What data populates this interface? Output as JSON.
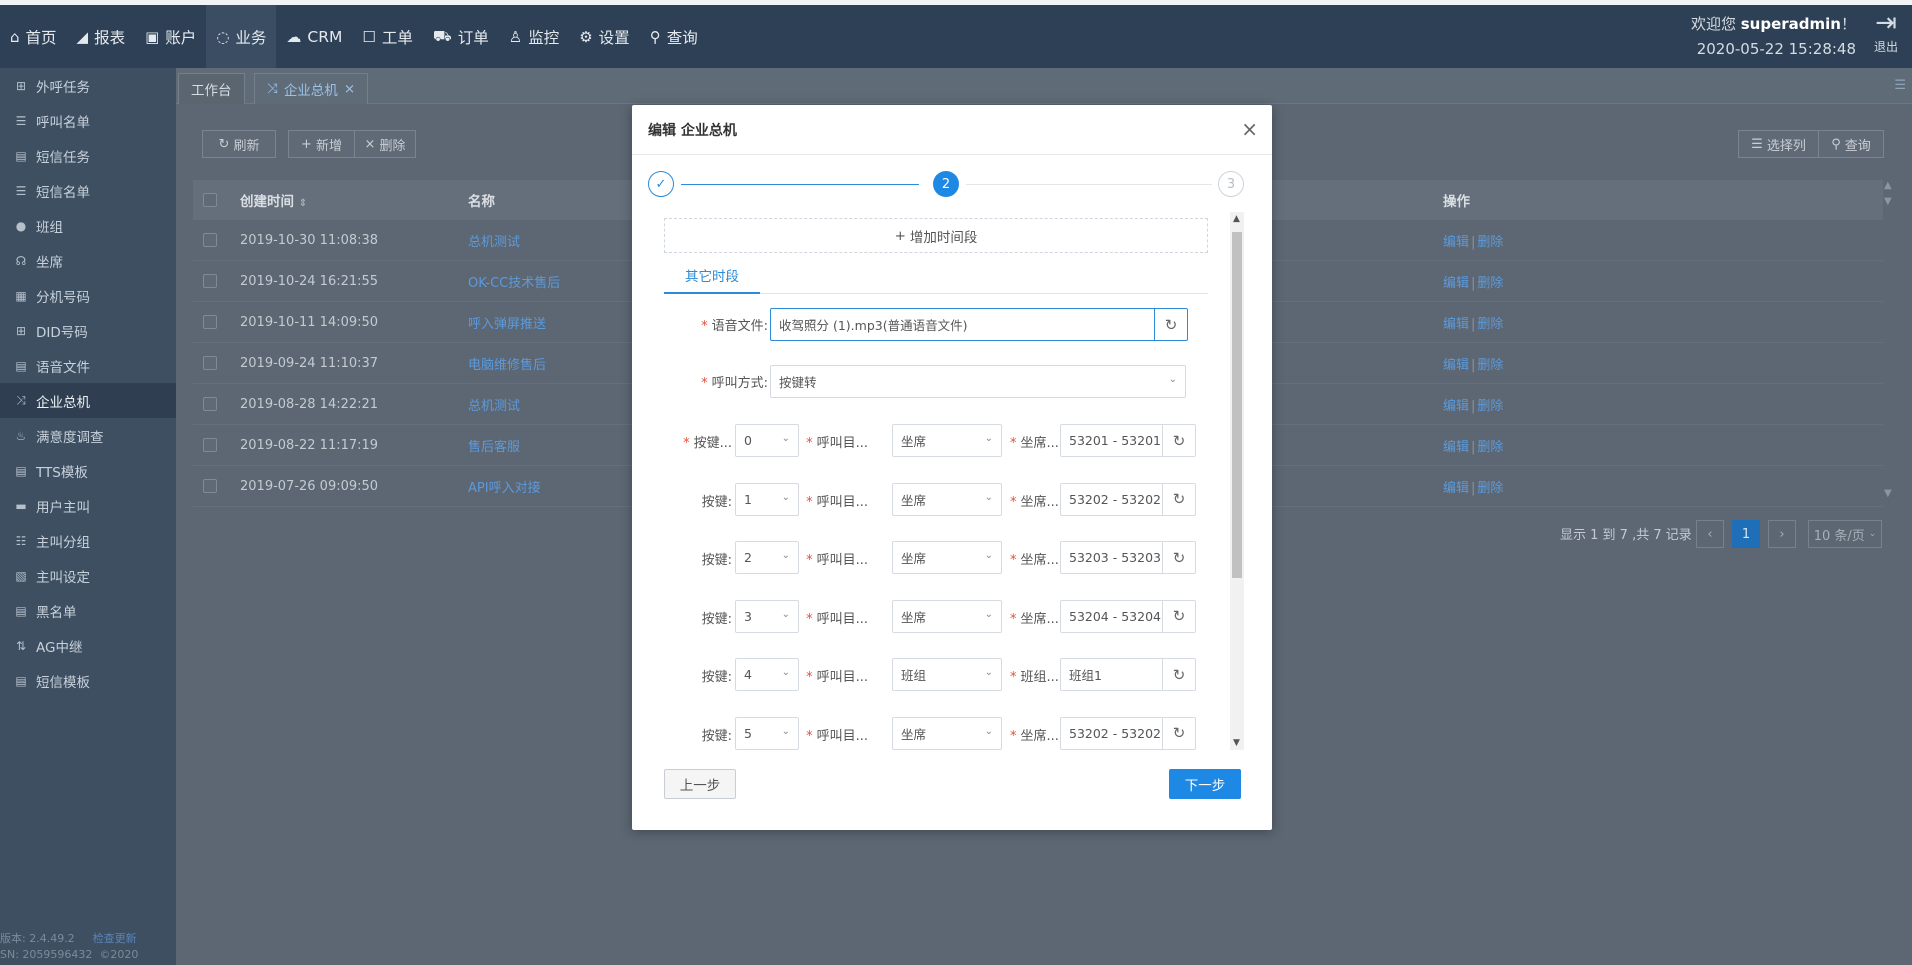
{
  "topnav": {
    "items": [
      {
        "icon": "home-icon",
        "glyph": "⌂",
        "label": "首页"
      },
      {
        "icon": "report-icon",
        "glyph": "◢",
        "label": "报表"
      },
      {
        "icon": "account-icon",
        "glyph": "▣",
        "label": "账户"
      },
      {
        "icon": "business-icon",
        "glyph": "◌",
        "label": "业务"
      },
      {
        "icon": "crm-icon",
        "glyph": "☁",
        "label": "CRM"
      },
      {
        "icon": "ticket-icon",
        "glyph": "☐",
        "label": "工单"
      },
      {
        "icon": "cart-icon",
        "glyph": "⛟",
        "label": "订单"
      },
      {
        "icon": "monitor-icon",
        "glyph": "♙",
        "label": "监控"
      },
      {
        "icon": "gear-icon",
        "glyph": "⚙",
        "label": "设置"
      },
      {
        "icon": "search-icon",
        "glyph": "⚲",
        "label": "查询"
      }
    ],
    "welcome_prefix": "欢迎您 ",
    "username": "superadmin",
    "welcome_suffix": "！",
    "datetime": "2020-05-22 15:28:48",
    "logout_label": "退出"
  },
  "sidebar": {
    "items": [
      {
        "icon": "grid-icon",
        "glyph": "⊞",
        "label": "外呼任务"
      },
      {
        "icon": "list-icon",
        "glyph": "☰",
        "label": "呼叫名单"
      },
      {
        "icon": "doc-icon",
        "glyph": "▤",
        "label": "短信任务"
      },
      {
        "icon": "list-icon",
        "glyph": "☰",
        "label": "短信名单"
      },
      {
        "icon": "group-icon",
        "glyph": "●",
        "label": "班组"
      },
      {
        "icon": "headset-icon",
        "glyph": "☊",
        "label": "坐席"
      },
      {
        "icon": "table-icon",
        "glyph": "▦",
        "label": "分机号码"
      },
      {
        "icon": "grid-icon",
        "glyph": "⊞",
        "label": "DID号码"
      },
      {
        "icon": "file-icon",
        "glyph": "▤",
        "label": "语音文件"
      },
      {
        "icon": "shuffle-icon",
        "glyph": "⤨",
        "label": "企业总机"
      },
      {
        "icon": "survey-icon",
        "glyph": "♨",
        "label": "满意度调查"
      },
      {
        "icon": "file-icon",
        "glyph": "▤",
        "label": "TTS模板"
      },
      {
        "icon": "card-icon",
        "glyph": "▬",
        "label": "用户主叫"
      },
      {
        "icon": "list-icon",
        "glyph": "☷",
        "label": "主叫分组"
      },
      {
        "icon": "setting-icon",
        "glyph": "▧",
        "label": "主叫设定"
      },
      {
        "icon": "blacklist-icon",
        "glyph": "▤",
        "label": "黑名单"
      },
      {
        "icon": "relay-icon",
        "glyph": "⇅",
        "label": "AG中继"
      },
      {
        "icon": "doc-icon",
        "glyph": "▤",
        "label": "短信模板"
      }
    ],
    "active_index": 9,
    "version": "版本: 2.4.49.2",
    "version_link": "检查更新",
    "sn": "SN: 2059596432",
    "copyright": "©2020"
  },
  "tabs": {
    "workbench": "工作台",
    "current": "企业总机",
    "close_glyph": "×"
  },
  "toolbar": {
    "refresh": "刷新",
    "add": "新增",
    "delete": "删除",
    "columns": "选择列",
    "query": "查询"
  },
  "table": {
    "headers": {
      "created": "创建时间",
      "name": "名称",
      "ops": "操作"
    },
    "rows": [
      {
        "time": "2019-10-30 11:08:38",
        "name": "总机测试"
      },
      {
        "time": "2019-10-24 16:21:55",
        "name": "OK-CC技术售后"
      },
      {
        "time": "2019-10-11 14:09:50",
        "name": "呼入弹屏推送"
      },
      {
        "time": "2019-09-24 11:10:37",
        "name": "电脑维修售后"
      },
      {
        "time": "2019-08-28 14:22:21",
        "name": "总机测试"
      },
      {
        "time": "2019-08-22 11:17:19",
        "name": "售后客服"
      },
      {
        "time": "2019-07-26 09:09:50",
        "name": "API呼入对接"
      }
    ],
    "op_edit": "编辑",
    "op_delete": "删除"
  },
  "pager": {
    "summary": "显示 1 到 7 ,共 7 记录",
    "current_page": "1",
    "page_size": "10 条/页"
  },
  "modal": {
    "title": "编辑 企业总机",
    "close_glyph": "×",
    "steps": [
      "✓",
      "2",
      "3"
    ],
    "add_period": "增加时间段",
    "sub_tab": "其它时段",
    "voice_label": "语音文件:",
    "voice_value": "收驾照分 (1).mp3(普通语音文件)",
    "call_mode_label": "呼叫方式:",
    "call_mode_value": "按键转",
    "key_rows": [
      {
        "key_label": "按键...",
        "key": "0",
        "target_label": "呼叫目...",
        "target": "坐席",
        "dest_label": "坐席...",
        "dest": "53201 - 53201"
      },
      {
        "key_label": "按键:",
        "key": "1",
        "target_label": "呼叫目...",
        "target": "坐席",
        "dest_label": "坐席...",
        "dest": "53202 - 53202"
      },
      {
        "key_label": "按键:",
        "key": "2",
        "target_label": "呼叫目...",
        "target": "坐席",
        "dest_label": "坐席...",
        "dest": "53203 - 53203"
      },
      {
        "key_label": "按键:",
        "key": "3",
        "target_label": "呼叫目...",
        "target": "坐席",
        "dest_label": "坐席...",
        "dest": "53204 - 53204"
      },
      {
        "key_label": "按键:",
        "key": "4",
        "target_label": "呼叫目...",
        "target": "班组",
        "dest_label": "班组...",
        "dest": "班组1"
      },
      {
        "key_label": "按键:",
        "key": "5",
        "target_label": "呼叫目...",
        "target": "坐席",
        "dest_label": "坐席...",
        "dest": "53202 - 53202"
      }
    ],
    "prev": "上一步",
    "next": "下一步"
  }
}
